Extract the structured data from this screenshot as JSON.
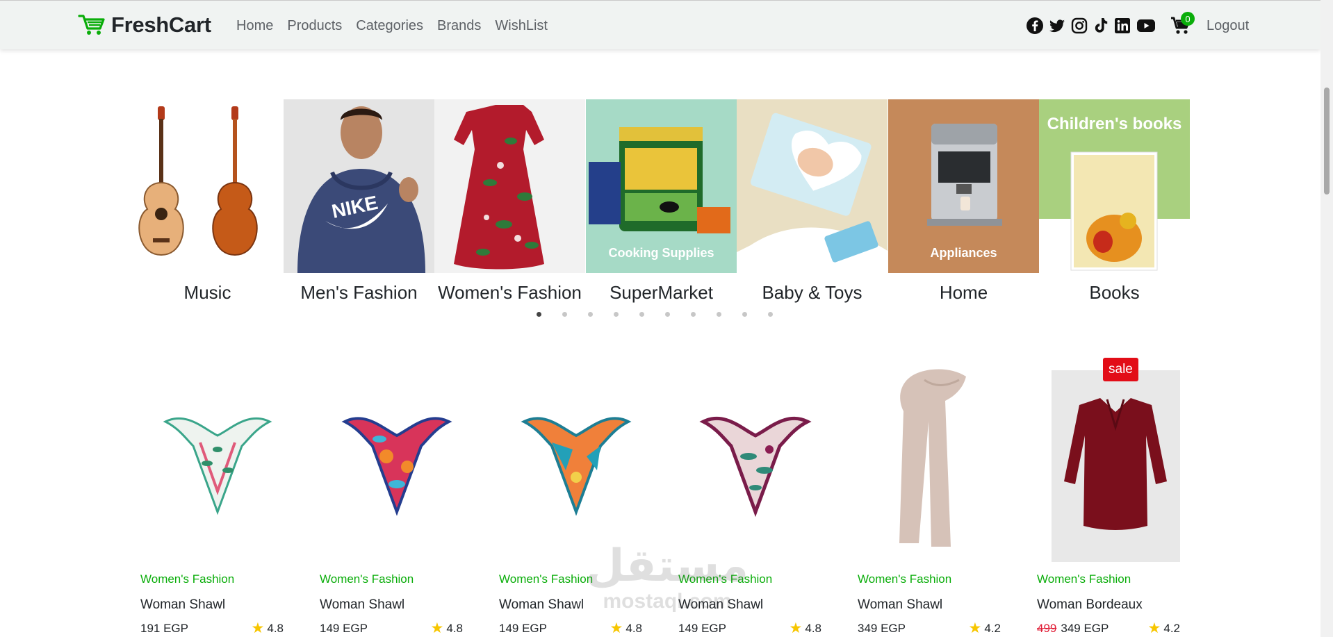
{
  "brand": {
    "name": "FreshCart",
    "icon": "cart-logo-icon"
  },
  "nav": {
    "links": [
      "Home",
      "Products",
      "Categories",
      "Brands",
      "WishList"
    ],
    "social_icons": [
      "facebook-icon",
      "twitter-icon",
      "instagram-icon",
      "tiktok-icon",
      "linkedin-icon",
      "youtube-icon"
    ],
    "cart_count": "0",
    "logout_label": "Logout"
  },
  "colors": {
    "accent": "#0aad0a",
    "sale": "#e20d17",
    "star": "#f7c600",
    "navbar_bg": "#f0f3f2"
  },
  "categories": [
    {
      "name": "Music",
      "overlay": ""
    },
    {
      "name": "Men's Fashion",
      "overlay": ""
    },
    {
      "name": "Women's Fashion",
      "overlay": ""
    },
    {
      "name": "SuperMarket",
      "overlay": "Cooking Supplies"
    },
    {
      "name": "Baby & Toys",
      "overlay": ""
    },
    {
      "name": "Home",
      "overlay": "Appliances"
    },
    {
      "name": "Books",
      "overlay": "Children's books"
    }
  ],
  "slider": {
    "dot_count": 10,
    "active_dot": 1
  },
  "products": [
    {
      "category": "Women's Fashion",
      "title": "Woman Shawl",
      "price": "191 EGP",
      "old_price": "",
      "rating": "4.8",
      "sale": ""
    },
    {
      "category": "Women's Fashion",
      "title": "Woman Shawl",
      "price": "149 EGP",
      "old_price": "",
      "rating": "4.8",
      "sale": ""
    },
    {
      "category": "Women's Fashion",
      "title": "Woman Shawl",
      "price": "149 EGP",
      "old_price": "",
      "rating": "4.8",
      "sale": ""
    },
    {
      "category": "Women's Fashion",
      "title": "Woman Shawl",
      "price": "149 EGP",
      "old_price": "",
      "rating": "4.8",
      "sale": ""
    },
    {
      "category": "Women's Fashion",
      "title": "Woman Shawl",
      "price": "349 EGP",
      "old_price": "",
      "rating": "4.2",
      "sale": ""
    },
    {
      "category": "Women's Fashion",
      "title": "Woman Bordeaux",
      "price": "349 EGP",
      "old_price": "499",
      "rating": "4.2",
      "sale": "sale"
    }
  ],
  "watermark": {
    "arabic": "مستقل",
    "latin": "mostaql.com"
  }
}
